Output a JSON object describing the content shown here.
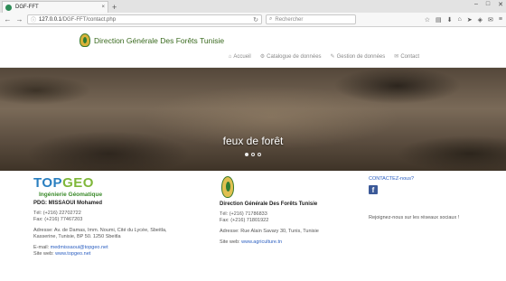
{
  "browser": {
    "tab_title": "DGF-FFT",
    "tab_close": "×",
    "new_tab": "+",
    "url_host": "127.0.0.1",
    "url_path": "/DGF-FFT/contact.php",
    "search_placeholder": "Rechercher",
    "window_controls": [
      "–",
      "□",
      "✕"
    ],
    "toolbar_icons": [
      "star-icon",
      "reader-icon",
      "download-icon",
      "home-icon",
      "share-icon",
      "shield-icon",
      "chat-icon",
      "menu-icon"
    ]
  },
  "site": {
    "title": "Direction Générale Des Forêts Tunisie",
    "menu": [
      {
        "label": "Accueil",
        "icon": "⌂"
      },
      {
        "label": "Catalogue de données",
        "icon": "⚙"
      },
      {
        "label": "Gestion de données",
        "icon": "✎"
      },
      {
        "label": "Contact",
        "icon": "✉"
      }
    ]
  },
  "hero": {
    "title": "feux de forêt",
    "slides": 3,
    "active_slide": 1
  },
  "footer": {
    "company": {
      "logo_top": "TOP",
      "logo_geo": "GEO",
      "logo_sub": "Ingénierie Géomatique",
      "pdg": "PDG: MISSAOUI Mohamed",
      "tel": "Tél: (+216) 22702722",
      "fax": "Fax: (+216) 77467203",
      "address": "Adresse: Av. de Damas, Imm. Noumi, Cité du Lycée, Sbeitla, Kasserine, Tunisie, BP 50. 1250 Sbeitla",
      "email_label": "E-mail:",
      "email": "medmissaoui@topgeo.net",
      "site_label": "Site web:",
      "site": "www.topgeo.net"
    },
    "dgf": {
      "name": "Direction Générale Des Forêts Tunisie",
      "tel": "Tél: (+216) 71786833",
      "fax": "Fax: (+216) 71801922",
      "address": "Adresse: Rue Alain Savary 30, Tunis, Tunisie",
      "site_label": "Site web:",
      "site": "www.agriculture.tn"
    },
    "contact": {
      "link": "CONTACTEZ-nous?",
      "facebook": "f",
      "social_text": "Rejoignez-nous sur les réseaux sociaux !"
    }
  }
}
